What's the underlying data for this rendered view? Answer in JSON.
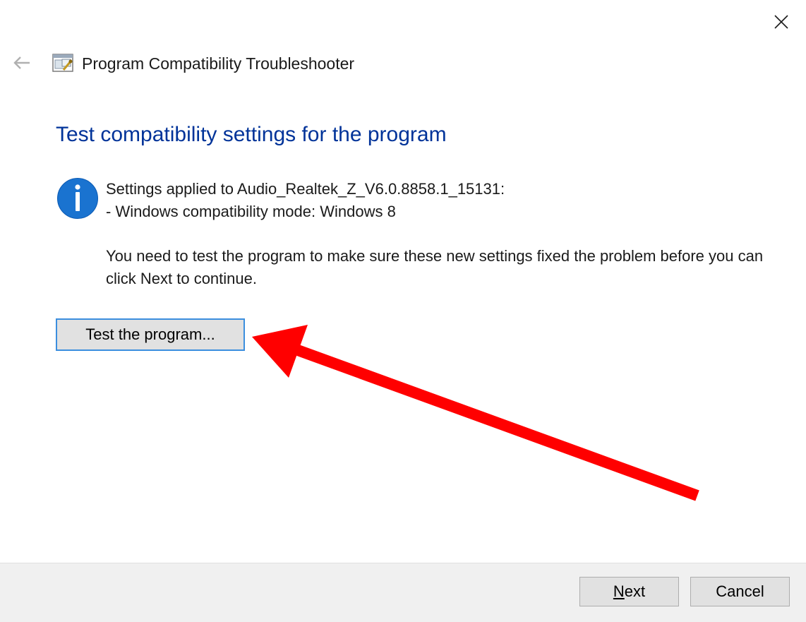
{
  "window": {
    "title": "Program Compatibility Troubleshooter",
    "back_icon": "back-arrow-icon",
    "close_icon": "close-icon",
    "app_icon": "troubleshooter-icon"
  },
  "content": {
    "heading": "Test compatibility settings for the program",
    "info_icon": "info-icon",
    "settings_applied": "Settings applied to Audio_Realtek_Z_V6.0.8858.1_15131:",
    "settings_item": "- Windows compatibility mode: Windows 8",
    "instructions": "You need to test the program to make sure these new settings fixed the problem before you can click Next to continue.",
    "test_button_label": "Test the program..."
  },
  "annotation": {
    "type": "arrow",
    "color": "#ff0000",
    "points_to": "test-program-button"
  },
  "footer": {
    "next_mnemonic": "N",
    "next_rest": "ext",
    "cancel_label": "Cancel"
  },
  "colors": {
    "heading": "#003399",
    "info_icon": "#1a73d0",
    "button_focus_border": "#3b8ede",
    "button_bg": "#e1e1e1",
    "footer_bg": "#f0f0f0"
  }
}
